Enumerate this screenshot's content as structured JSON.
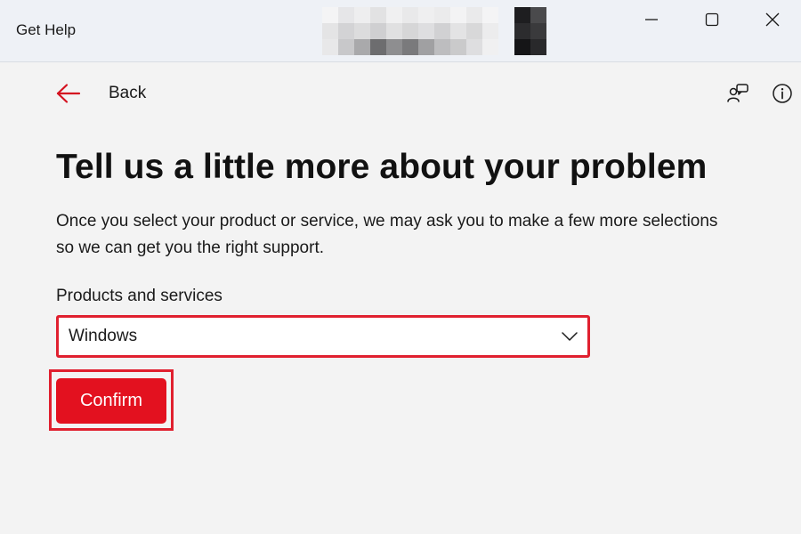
{
  "window": {
    "title": "Get Help",
    "minimize_icon": "minimize-icon",
    "maximize_icon": "maximize-icon",
    "close_icon": "close-icon"
  },
  "header": {
    "back_label": "Back",
    "back_icon": "arrow-left-icon",
    "feedback_icon": "feedback-icon",
    "info_icon": "info-icon"
  },
  "main": {
    "title": "Tell us a little more about your problem",
    "description": "Once you select your product or service, we may ask you to make a few more selections so we can get you the right support.",
    "products_label": "Products and services",
    "products_value": "Windows",
    "confirm_label": "Confirm"
  },
  "colors": {
    "accent": "#e3111f",
    "highlight_border": "#e0202f",
    "titlebar_bg": "#eef1f6",
    "page_bg": "#f3f3f3"
  }
}
